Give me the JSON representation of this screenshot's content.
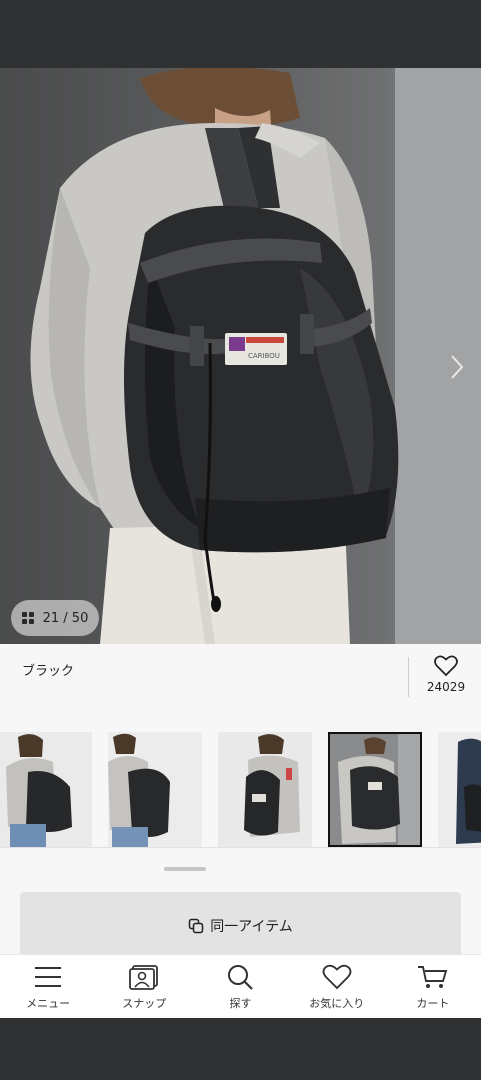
{
  "gallery": {
    "counter": "21 / 50",
    "current_index": 21,
    "total": 50
  },
  "product": {
    "color_name": "ブラック",
    "favorite_count": "24029",
    "tag_text": "CARIBOU"
  },
  "thumbnails": [
    {
      "label": "thumb-1",
      "selected": false
    },
    {
      "label": "thumb-2",
      "selected": false
    },
    {
      "label": "thumb-3",
      "selected": false
    },
    {
      "label": "thumb-4",
      "selected": true
    },
    {
      "label": "thumb-5",
      "selected": false
    }
  ],
  "actions": {
    "same_item_label": "同一アイテム"
  },
  "nav": {
    "items": [
      {
        "label": "メニュー",
        "icon": "menu-icon"
      },
      {
        "label": "スナップ",
        "icon": "snap-icon"
      },
      {
        "label": "探す",
        "icon": "search-icon"
      },
      {
        "label": "お気に入り",
        "icon": "heart-icon"
      },
      {
        "label": "カート",
        "icon": "cart-icon"
      }
    ]
  },
  "colors": {
    "system_bar": "#303132",
    "background": "#f7f7f7",
    "button_bg": "#e3e3e3",
    "selected_outline": "#111111"
  }
}
